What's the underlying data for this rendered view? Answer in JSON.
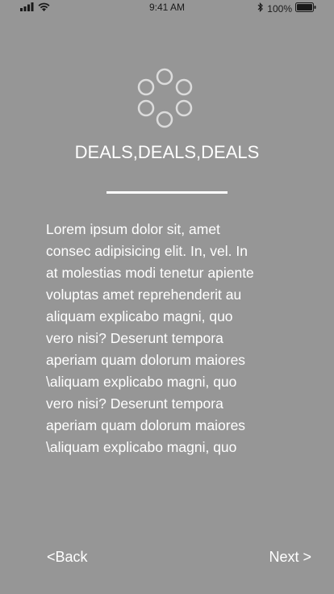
{
  "status_bar": {
    "time": "9:41 AM",
    "battery": "100%",
    "icons": [
      "signal-icon",
      "wifi-icon",
      "bluetooth-icon",
      "battery-icon"
    ]
  },
  "loader": {
    "icon": "loading-spinner-icon"
  },
  "title": "DEALS,DEALS,DEALS",
  "body": "Lorem ipsum dolor sit, amet\nconsec adipisicing elit. In, vel. In\nat molestias modi tenetur apiente\nvoluptas amet reprehenderit au\naliquam explicabo magni, quo\nvero nisi? Deserunt tempora\naperiam quam dolorum maiores\n\\aliquam explicabo magni, quo\nvero nisi? Deserunt tempora\naperiam quam dolorum maiores\n\\aliquam explicabo magni, quo",
  "nav": {
    "back_label": "<Back",
    "next_label": "Next >"
  },
  "colors": {
    "background": "#969696",
    "text": "#ffffff",
    "status_text": "#1a1a1a"
  }
}
